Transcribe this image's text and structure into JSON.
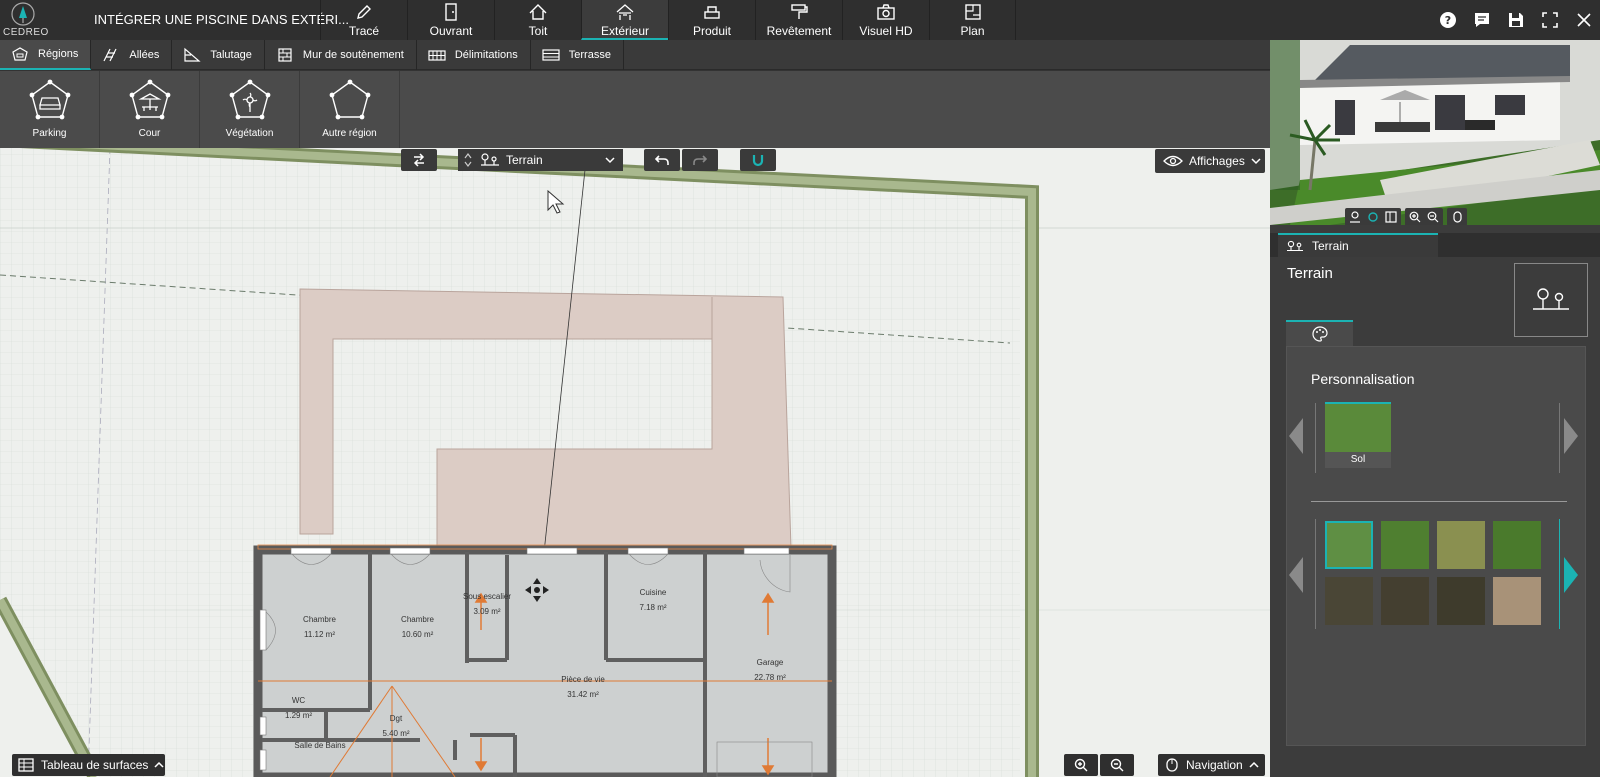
{
  "app": {
    "logo_text": "CEDREO",
    "project_title": "INTÉGRER UNE PISCINE DANS EXTÉRI..."
  },
  "topnav": [
    {
      "label": "Tracé",
      "icon": "pencil-icon"
    },
    {
      "label": "Ouvrant",
      "icon": "door-icon"
    },
    {
      "label": "Toit",
      "icon": "roof-icon"
    },
    {
      "label": "Extérieur",
      "icon": "exterior-icon",
      "active": true
    },
    {
      "label": "Produit",
      "icon": "product-icon"
    },
    {
      "label": "Revêtement",
      "icon": "paint-roller-icon"
    },
    {
      "label": "Visuel HD",
      "icon": "camera-icon"
    },
    {
      "label": "Plan",
      "icon": "plan-icon"
    }
  ],
  "subtabs": [
    {
      "label": "Régions",
      "active": true
    },
    {
      "label": "Allées"
    },
    {
      "label": "Talutage"
    },
    {
      "label": "Mur de soutènement"
    },
    {
      "label": "Délimitations"
    },
    {
      "label": "Terrasse"
    }
  ],
  "regions": [
    {
      "label": "Parking"
    },
    {
      "label": "Cour"
    },
    {
      "label": "Végétation"
    },
    {
      "label": "Autre région"
    }
  ],
  "toolbar": {
    "layer": "Terrain",
    "display": "Affichages"
  },
  "rooms": [
    {
      "name": "Chambre",
      "area": "11.12 m²"
    },
    {
      "name": "Chambre",
      "area": "10.60 m²"
    },
    {
      "name": "Sous escalier",
      "area": "3.09 m²"
    },
    {
      "name": "Cuisine",
      "area": "7.18 m²"
    },
    {
      "name": "Pièce de vie",
      "area": "31.42 m²"
    },
    {
      "name": "Garage",
      "area": "22.78 m²"
    },
    {
      "name": "WC",
      "area": "1.29 m²"
    },
    {
      "name": "Dgt",
      "area": "5.40 m²"
    },
    {
      "name": "Salle de Bains",
      "area": ""
    }
  ],
  "bottom": {
    "surfaces": "Tableau de surfaces",
    "navigation": "Navigation"
  },
  "panel": {
    "tab": "Terrain",
    "title": "Terrain",
    "section": "Personnalisation",
    "selected_material": "Sol"
  },
  "colors": {
    "accent": "#1bb3b3",
    "topbar": "#2f2f2f",
    "region": "#d9c9c3",
    "boundary": "#8a9a6e"
  }
}
